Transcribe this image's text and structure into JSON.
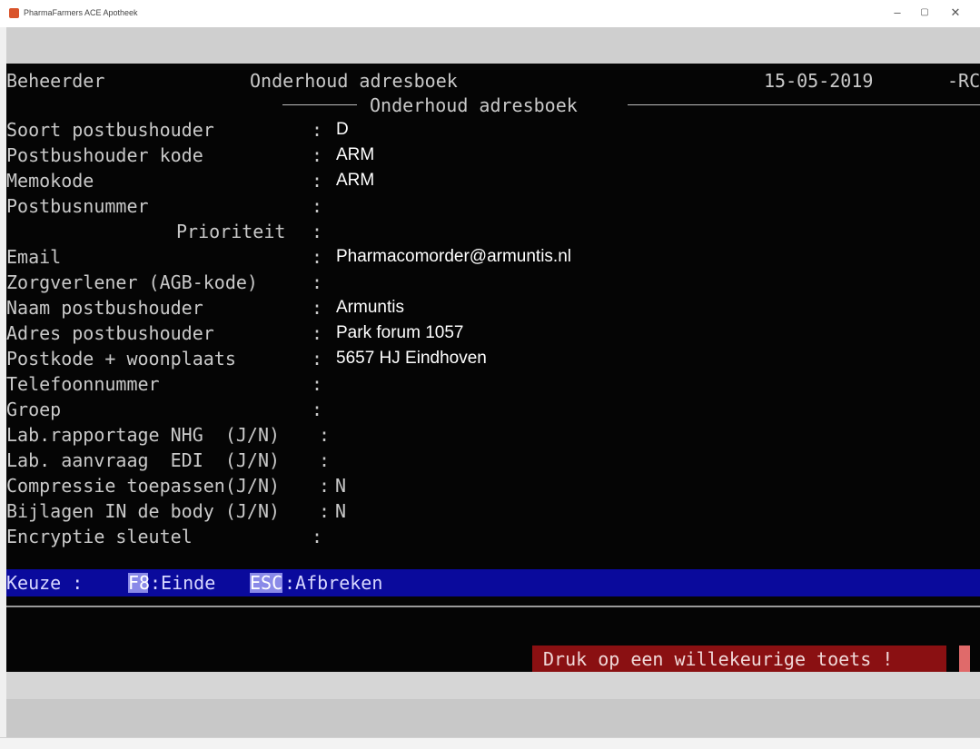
{
  "window": {
    "title": "PharmaFarmers ACE Apotheek",
    "controls": {
      "minimize": "–",
      "maximize": "▢",
      "close": "✕"
    }
  },
  "header": {
    "user": "Beheerder",
    "screen": "Onderhoud adresboek",
    "date": "15-05-2019",
    "cut_text": "-RC",
    "subtitle": "Onderhoud adresboek"
  },
  "form": {
    "fields": [
      {
        "label": "Soort postbushouder",
        "colon": ":",
        "value": "D"
      },
      {
        "label": "Postbushouder kode",
        "colon": ":",
        "value": "ARM"
      },
      {
        "label": "Memokode",
        "colon": ":",
        "value": "ARM"
      },
      {
        "label": "Postbusnummer",
        "colon": ":",
        "value": ""
      },
      {
        "label": "Prioriteit",
        "colon": ":",
        "value": ""
      },
      {
        "label": "Email",
        "colon": ":",
        "value": "Pharmacomorder@armuntis.nl"
      },
      {
        "label": "Zorgverlener (AGB-kode)",
        "colon": ":",
        "value": ""
      },
      {
        "label": "Naam postbushouder",
        "colon": ":",
        "value": "Armuntis"
      },
      {
        "label": "Adres postbushouder",
        "colon": ":",
        "value": "Park forum 1057"
      },
      {
        "label": "Postkode + woonplaats",
        "colon": ":",
        "value": "5657 HJ Eindhoven"
      },
      {
        "label": "Telefoonnummer",
        "colon": ":",
        "value": ""
      },
      {
        "label": "Groep",
        "colon": ":",
        "value": ""
      },
      {
        "label": "Lab.rapportage NHG  (J/N)",
        "colon": ":",
        "value": ""
      },
      {
        "label": "Lab. aanvraag  EDI  (J/N)",
        "colon": ":",
        "value": ""
      },
      {
        "label": "Compressie toepassen(J/N)",
        "colon": ":",
        "value": "N"
      },
      {
        "label": "Bijlagen IN de body (J/N)",
        "colon": ":",
        "value": "N"
      },
      {
        "label": "Encryptie sleutel",
        "colon": ":",
        "value": ""
      }
    ]
  },
  "keuze": {
    "label": "Keuze :",
    "f8_key": "F8",
    "f8_action": ":Einde",
    "esc_key": "ESC",
    "esc_action": ":Afbreken"
  },
  "prompt": "Druk op een willekeurige toets !",
  "colors": {
    "terminal_bg": "#050505",
    "terminal_text": "#c9c9c9",
    "menu_bar": "#0a0a9c",
    "prompt_bg": "#8a1012"
  }
}
